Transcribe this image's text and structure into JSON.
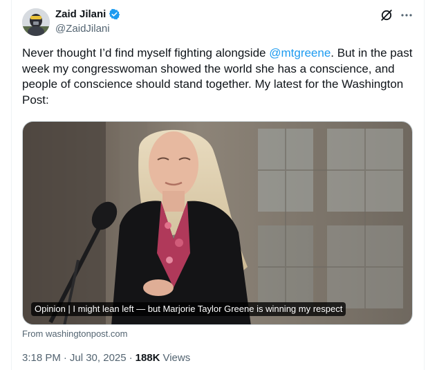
{
  "author": {
    "name": "Zaid Jilani",
    "handle": "@ZaidJilani"
  },
  "tweet": {
    "text_before": "Never thought I’d find myself fighting alongside ",
    "mention": "@mtgreene",
    "text_after": ". But in the past week my congresswoman showed the world she has a conscience, and people of conscience should stand together. My latest for the Washington Post:"
  },
  "card": {
    "caption": "Opinion | I might lean left — but Marjorie Taylor Greene is winning my respect",
    "source": "From washingtonpost.com"
  },
  "meta": {
    "time": "3:18 PM",
    "dot1": "·",
    "date": "Jul 30, 2025",
    "dot2": "·",
    "views_count": "188K",
    "views_label": "Views"
  },
  "icons": {
    "verified": "verified-badge-icon",
    "grok": "grok-icon",
    "more": "more-icon"
  },
  "colors": {
    "accent": "#1d9bf0",
    "secondary_text": "#536471",
    "primary_text": "#0f1419"
  }
}
